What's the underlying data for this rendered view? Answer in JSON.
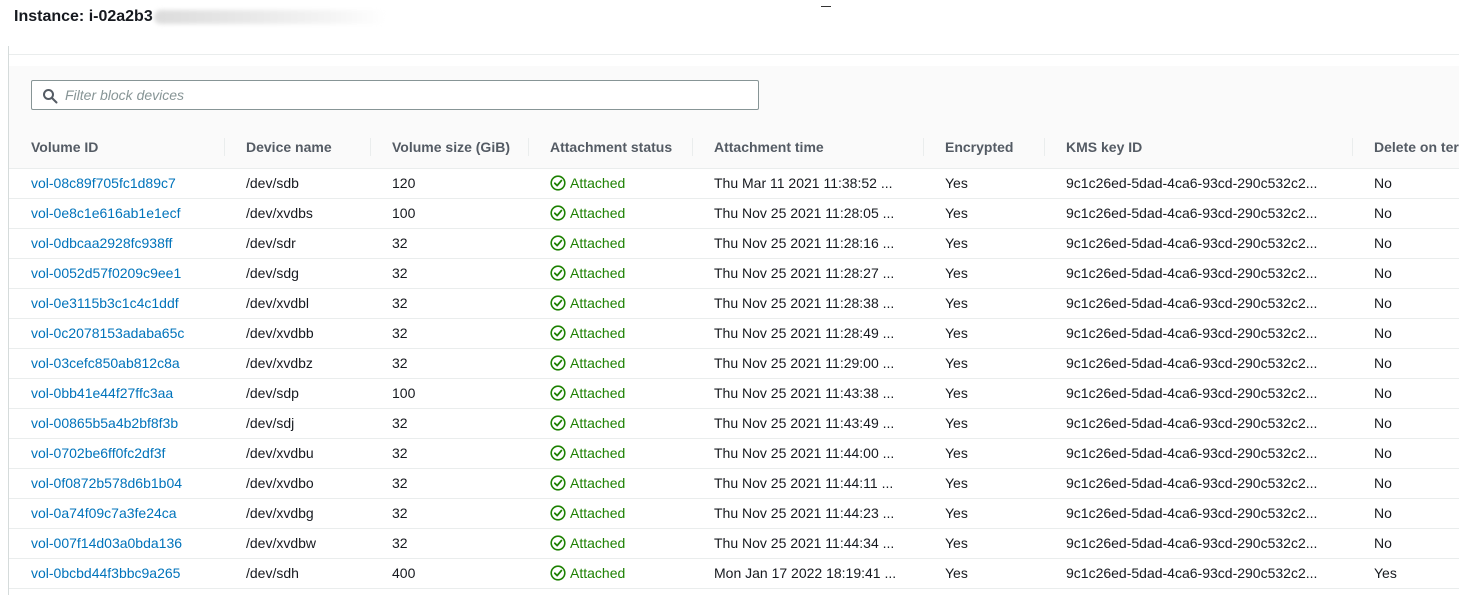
{
  "header": {
    "instance_label": "Instance: i-02a2b3"
  },
  "filter": {
    "placeholder": "Filter block devices",
    "value": ""
  },
  "columns": {
    "volume_id": "Volume ID",
    "device_name": "Device name",
    "volume_size": "Volume size (GiB)",
    "attachment_status": "Attachment status",
    "attachment_time": "Attachment time",
    "encrypted": "Encrypted",
    "kms_key_id": "KMS key ID",
    "delete_on_termination": "Delete on ter"
  },
  "rows": [
    {
      "volume_id": "vol-08c89f705fc1d89c7",
      "device": "/dev/sdb",
      "size": "120",
      "status": "Attached",
      "time": "Thu Mar 11 2021 11:38:52 ...",
      "encrypted": "Yes",
      "kms": "9c1c26ed-5dad-4ca6-93cd-290c532c2...",
      "delete": "No"
    },
    {
      "volume_id": "vol-0e8c1e616ab1e1ecf",
      "device": "/dev/xvdbs",
      "size": "100",
      "status": "Attached",
      "time": "Thu Nov 25 2021 11:28:05 ...",
      "encrypted": "Yes",
      "kms": "9c1c26ed-5dad-4ca6-93cd-290c532c2...",
      "delete": "No"
    },
    {
      "volume_id": "vol-0dbcaa2928fc938ff",
      "device": "/dev/sdr",
      "size": "32",
      "status": "Attached",
      "time": "Thu Nov 25 2021 11:28:16 ...",
      "encrypted": "Yes",
      "kms": "9c1c26ed-5dad-4ca6-93cd-290c532c2...",
      "delete": "No"
    },
    {
      "volume_id": "vol-0052d57f0209c9ee1",
      "device": "/dev/sdg",
      "size": "32",
      "status": "Attached",
      "time": "Thu Nov 25 2021 11:28:27 ...",
      "encrypted": "Yes",
      "kms": "9c1c26ed-5dad-4ca6-93cd-290c532c2...",
      "delete": "No"
    },
    {
      "volume_id": "vol-0e3115b3c1c4c1ddf",
      "device": "/dev/xvdbl",
      "size": "32",
      "status": "Attached",
      "time": "Thu Nov 25 2021 11:28:38 ...",
      "encrypted": "Yes",
      "kms": "9c1c26ed-5dad-4ca6-93cd-290c532c2...",
      "delete": "No"
    },
    {
      "volume_id": "vol-0c2078153adaba65c",
      "device": "/dev/xvdbb",
      "size": "32",
      "status": "Attached",
      "time": "Thu Nov 25 2021 11:28:49 ...",
      "encrypted": "Yes",
      "kms": "9c1c26ed-5dad-4ca6-93cd-290c532c2...",
      "delete": "No"
    },
    {
      "volume_id": "vol-03cefc850ab812c8a",
      "device": "/dev/xvdbz",
      "size": "32",
      "status": "Attached",
      "time": "Thu Nov 25 2021 11:29:00 ...",
      "encrypted": "Yes",
      "kms": "9c1c26ed-5dad-4ca6-93cd-290c532c2...",
      "delete": "No"
    },
    {
      "volume_id": "vol-0bb41e44f27ffc3aa",
      "device": "/dev/sdp",
      "size": "100",
      "status": "Attached",
      "time": "Thu Nov 25 2021 11:43:38 ...",
      "encrypted": "Yes",
      "kms": "9c1c26ed-5dad-4ca6-93cd-290c532c2...",
      "delete": "No"
    },
    {
      "volume_id": "vol-00865b5a4b2bf8f3b",
      "device": "/dev/sdj",
      "size": "32",
      "status": "Attached",
      "time": "Thu Nov 25 2021 11:43:49 ...",
      "encrypted": "Yes",
      "kms": "9c1c26ed-5dad-4ca6-93cd-290c532c2...",
      "delete": "No"
    },
    {
      "volume_id": "vol-0702be6ff0fc2df3f",
      "device": "/dev/xvdbu",
      "size": "32",
      "status": "Attached",
      "time": "Thu Nov 25 2021 11:44:00 ...",
      "encrypted": "Yes",
      "kms": "9c1c26ed-5dad-4ca6-93cd-290c532c2...",
      "delete": "No"
    },
    {
      "volume_id": "vol-0f0872b578d6b1b04",
      "device": "/dev/xvdbo",
      "size": "32",
      "status": "Attached",
      "time": "Thu Nov 25 2021 11:44:11 ...",
      "encrypted": "Yes",
      "kms": "9c1c26ed-5dad-4ca6-93cd-290c532c2...",
      "delete": "No"
    },
    {
      "volume_id": "vol-0a74f09c7a3fe24ca",
      "device": "/dev/xvdbg",
      "size": "32",
      "status": "Attached",
      "time": "Thu Nov 25 2021 11:44:23 ...",
      "encrypted": "Yes",
      "kms": "9c1c26ed-5dad-4ca6-93cd-290c532c2...",
      "delete": "No"
    },
    {
      "volume_id": "vol-007f14d03a0bda136",
      "device": "/dev/xvdbw",
      "size": "32",
      "status": "Attached",
      "time": "Thu Nov 25 2021 11:44:34 ...",
      "encrypted": "Yes",
      "kms": "9c1c26ed-5dad-4ca6-93cd-290c532c2...",
      "delete": "No"
    },
    {
      "volume_id": "vol-0bcbd44f3bbc9a265",
      "device": "/dev/sdh",
      "size": "400",
      "status": "Attached",
      "time": "Mon Jan 17 2022 18:19:41 ...",
      "encrypted": "Yes",
      "kms": "9c1c26ed-5dad-4ca6-93cd-290c532c2...",
      "delete": "Yes"
    }
  ],
  "colors": {
    "link": "#0073bb",
    "success": "#1d8102",
    "header_text": "#545b64",
    "border": "#eaeded"
  },
  "icons": {
    "search": "search-icon",
    "status_ok": "status-success-icon"
  }
}
